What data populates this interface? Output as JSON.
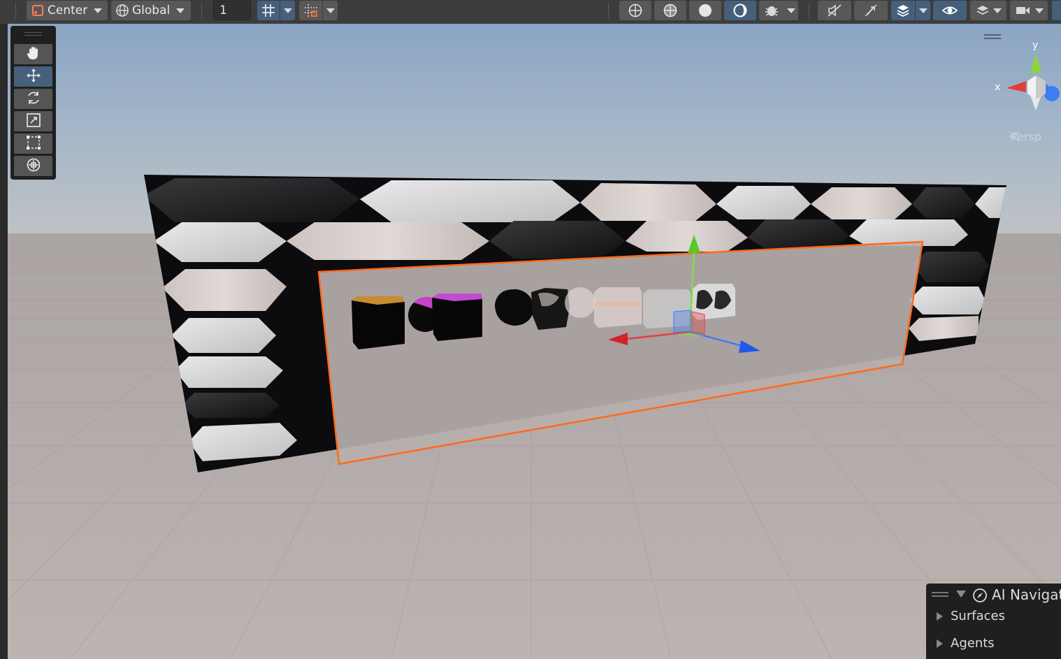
{
  "toolbar": {
    "pivot_mode": "Center",
    "pivot_rotation": "Global",
    "grid_snap_value": "1",
    "icons": [
      "pivot-icon",
      "globe-icon",
      "grid-snap-icon",
      "snap-increment-icon",
      "wireframe-icon",
      "shaded-wireframe-icon",
      "shaded-icon",
      "lit-icon",
      "debug-icon",
      "audio-off-icon",
      "fx-off-icon",
      "scene-visibility-icon",
      "visibility-icon",
      "layers-icon",
      "camera-icon"
    ]
  },
  "tools": [
    {
      "name": "hand-tool",
      "icon": "hand-icon"
    },
    {
      "name": "move-tool",
      "icon": "move-icon",
      "active": true
    },
    {
      "name": "rotate-tool",
      "icon": "rotate-icon"
    },
    {
      "name": "scale-tool",
      "icon": "scale-icon"
    },
    {
      "name": "rect-tool",
      "icon": "rect-icon"
    },
    {
      "name": "transform-tool",
      "icon": "transform-icon"
    }
  ],
  "gizmo": {
    "y_label": "y",
    "x_label": "x",
    "projection_label": "Persp",
    "colors": {
      "x": "#e0403a",
      "y": "#8bd43b",
      "z": "#3d7cf2"
    }
  },
  "ai_navigation": {
    "title": "AI Navigat",
    "items": [
      "Surfaces",
      "Agents"
    ]
  },
  "colors": {
    "accent": "#46607c",
    "selection": "#ff6a1a",
    "sky_top": "#8aa6c4",
    "ground": "#b7aeab"
  }
}
